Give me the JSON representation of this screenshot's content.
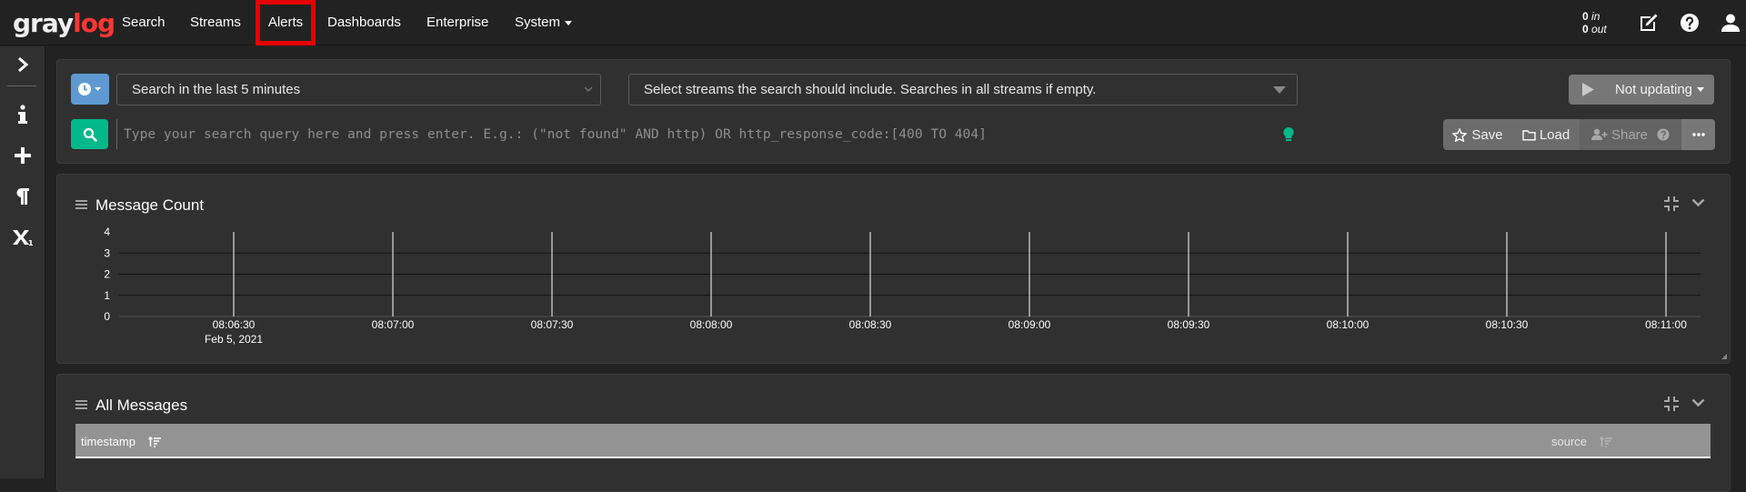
{
  "nav": {
    "logo_main": "gray",
    "logo_accent": "log",
    "items": [
      {
        "label": "Search"
      },
      {
        "label": "Streams"
      },
      {
        "label": "Alerts"
      },
      {
        "label": "Dashboards"
      },
      {
        "label": "Enterprise"
      },
      {
        "label": "System"
      }
    ],
    "throughput_in_value": "0",
    "throughput_in_label": "in",
    "throughput_out_value": "0",
    "throughput_out_label": "out",
    "icons": [
      "edit-icon",
      "help-icon",
      "user-icon"
    ]
  },
  "sidebar": {
    "icons": [
      "chevron-right-icon",
      "info-icon",
      "plus-icon",
      "paragraph-icon",
      "subscript-icon"
    ]
  },
  "search_bar": {
    "time_range": "Search in the last 5 minutes",
    "streams_placeholder": "Select streams the search should include. Searches in all streams if empty.",
    "refresh_label": "Not updating",
    "query_placeholder": "Type your search query here and press enter. E.g.: (\"not found\" AND http) OR http_response_code:[400 TO 404]",
    "save_label": "Save",
    "load_label": "Load",
    "share_label": "Share"
  },
  "message_count": {
    "title": "Message Count"
  },
  "chart_data": {
    "type": "bar",
    "title": "Message Count",
    "xlabel": "",
    "ylabel": "",
    "x_tick_labels": [
      "08:06:30",
      "08:07:00",
      "08:07:30",
      "08:08:00",
      "08:08:30",
      "08:09:00",
      "08:09:30",
      "08:10:00",
      "08:10:30",
      "08:11:00"
    ],
    "x_date_label": "Feb 5, 2021",
    "y_tick_labels": [
      "0",
      "1",
      "2",
      "3",
      "4"
    ],
    "ylim": [
      0,
      4
    ],
    "values": [],
    "grid": true
  },
  "all_messages": {
    "title": "All Messages",
    "columns": [
      {
        "label": "timestamp"
      },
      {
        "label": "source"
      }
    ]
  },
  "colors": {
    "background": "#222222",
    "panel": "#303030",
    "time_button": "#5e9ad1",
    "search_button": "#00b889",
    "logo_accent": "#ff3633",
    "highlight": "#e60000",
    "bulb": "#00b889"
  }
}
